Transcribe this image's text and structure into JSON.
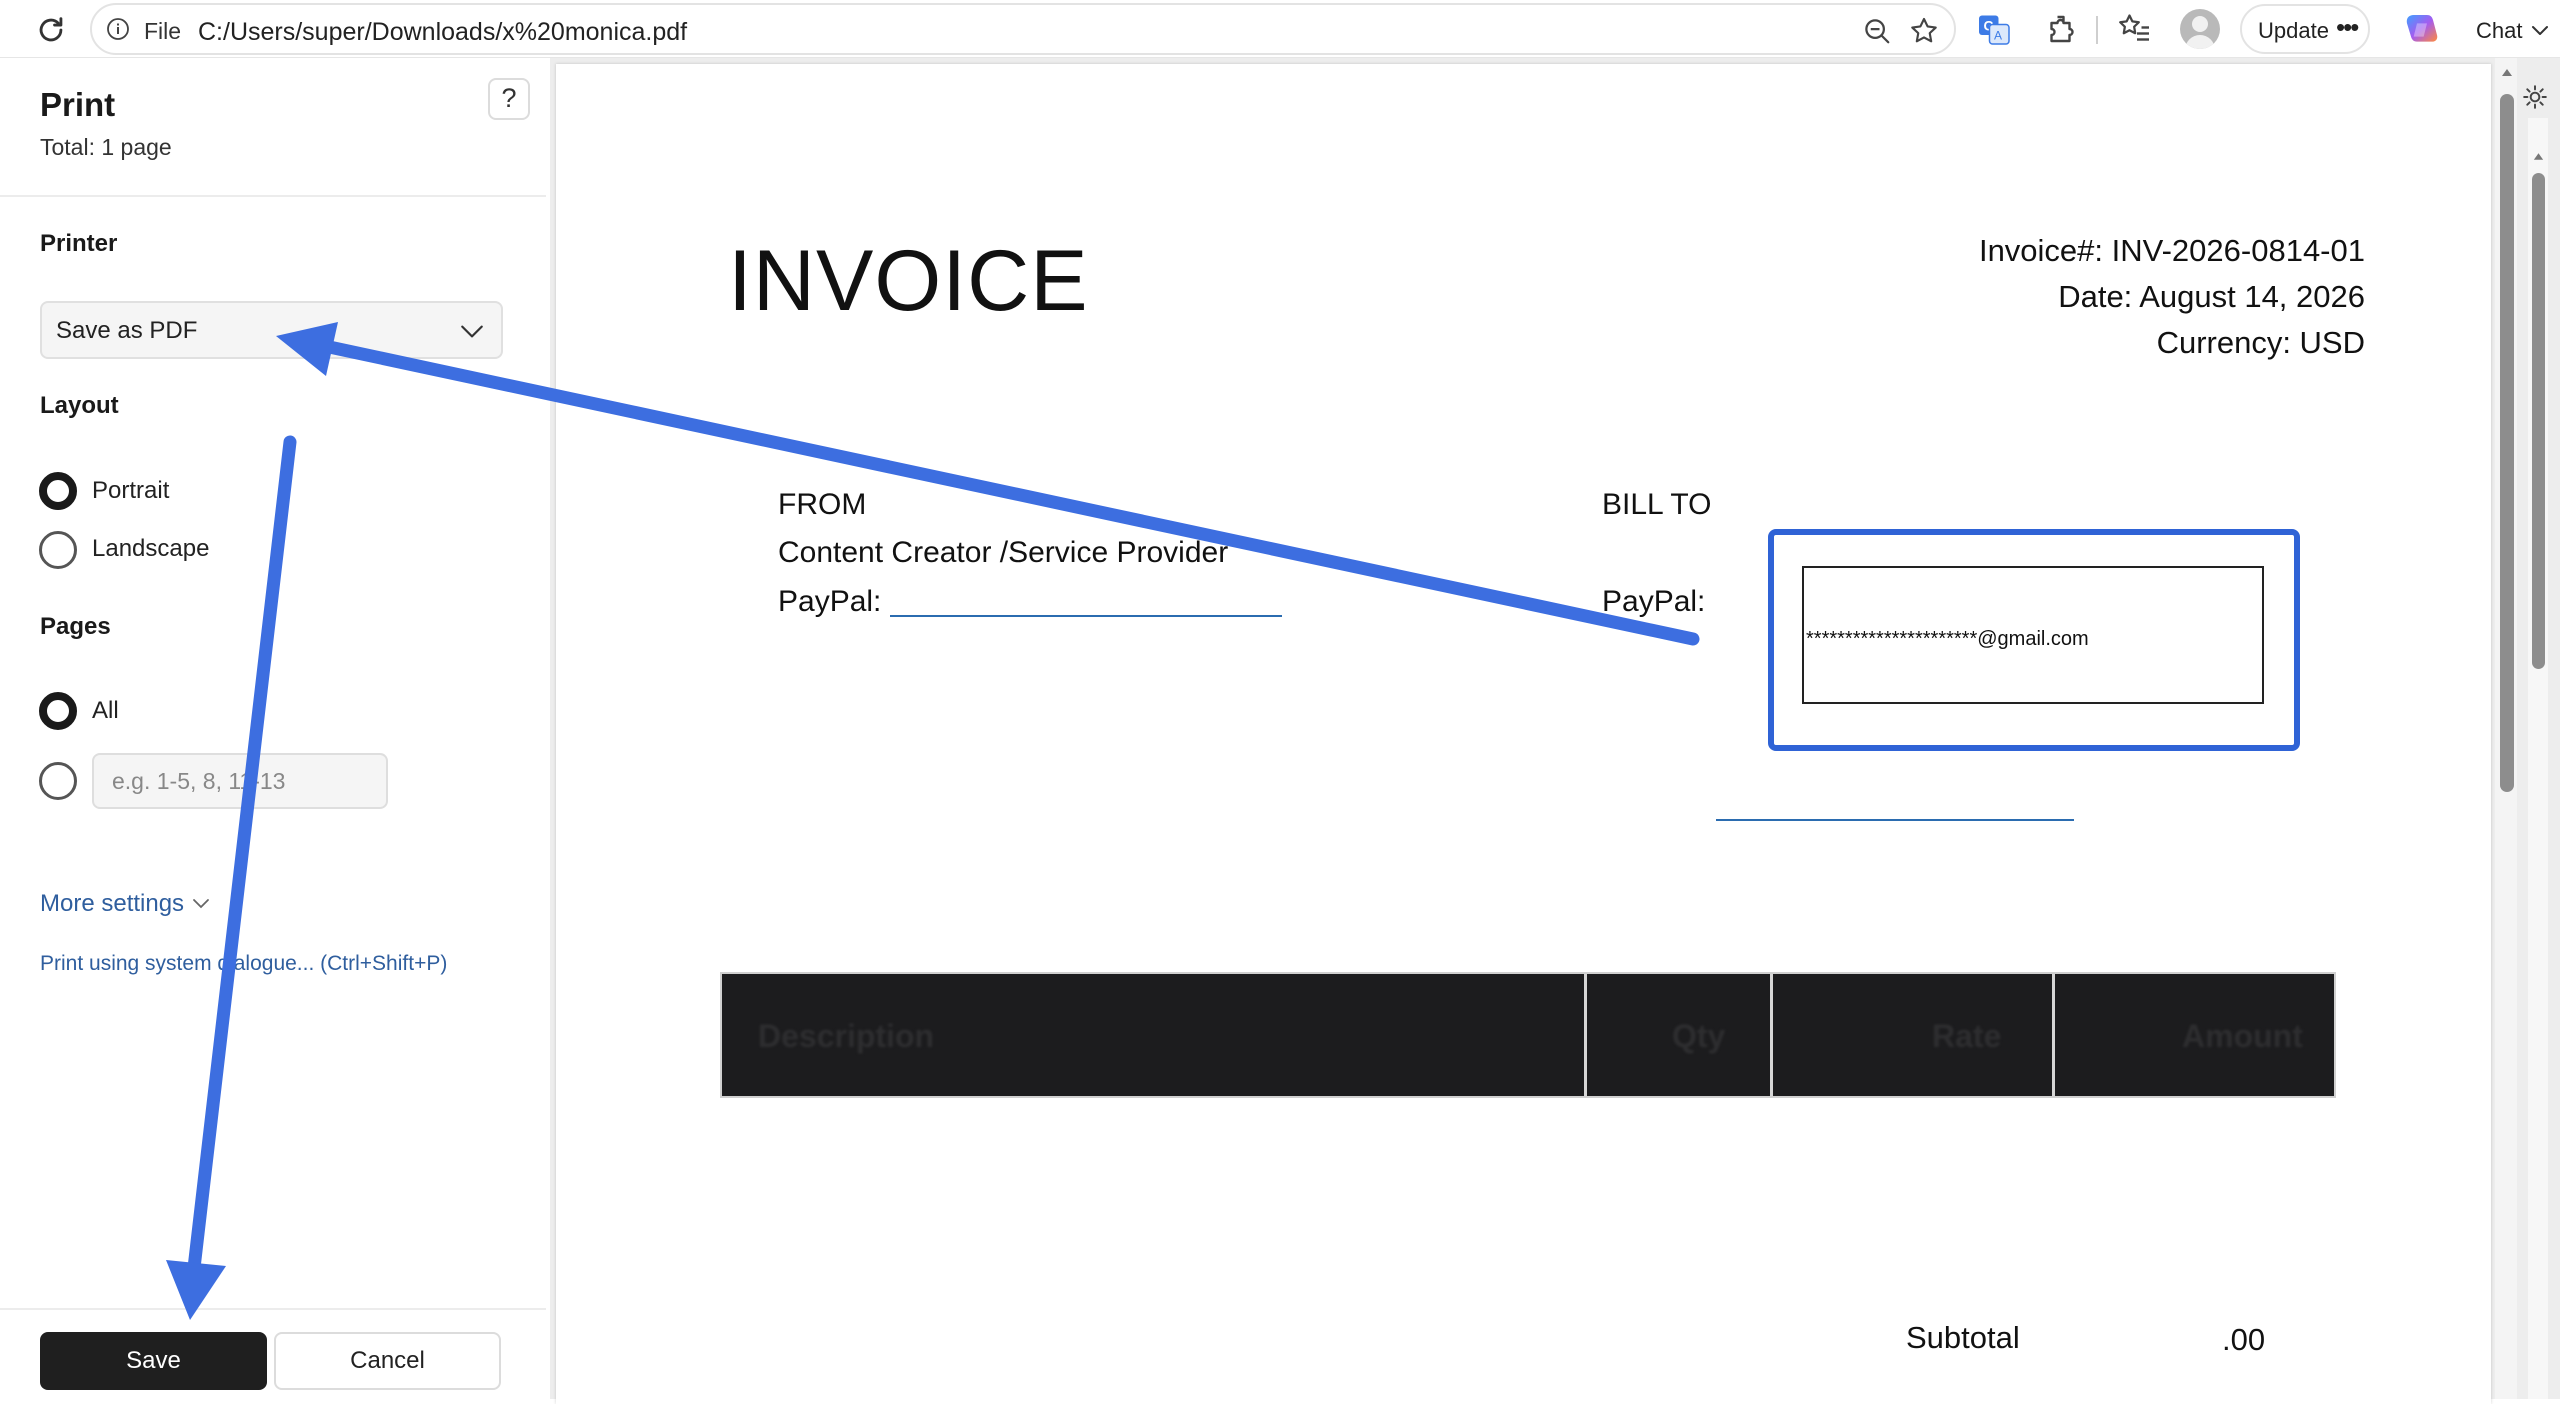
{
  "browser": {
    "address": {
      "scheme": "File",
      "url": "C:/Users/super/Downloads/x%20monica.pdf"
    },
    "update_label": "Update",
    "chat_label": "Chat",
    "icons": [
      "reload-icon",
      "info-icon",
      "zoom-out-icon",
      "favorite-star-icon",
      "translate-icon",
      "extensions-icon",
      "favorites-list-icon",
      "profile-avatar",
      "more-icon",
      "copilot-icon",
      "chevron-down-icon"
    ]
  },
  "print_panel": {
    "title": "Print",
    "total": "Total: 1 page",
    "help_label": "?",
    "printer_label": "Printer",
    "printer_value": "Save as PDF",
    "layout_label": "Layout",
    "layout_options": [
      {
        "label": "Portrait",
        "selected": true
      },
      {
        "label": "Landscape",
        "selected": false
      }
    ],
    "pages_label": "Pages",
    "pages_options": [
      {
        "label": "All",
        "selected": true
      }
    ],
    "pages_custom_placeholder": "e.g. 1-5, 8, 11-13",
    "more_settings": "More settings",
    "system_dialog": "Print using system dialogue... (Ctrl+Shift+P)",
    "save_label": "Save",
    "cancel_label": "Cancel"
  },
  "invoice": {
    "title": "INVOICE",
    "invoice_number": "Invoice#: INV-2026-0814-01",
    "date": "Date: August 14, 2026",
    "currency": "Currency: USD",
    "from_label": "FROM",
    "from_name": "Content Creator /Service Provider",
    "from_paypal_label": "PayPal:",
    "bill_to_label": "BILL TO",
    "bill_to_paypal_label": "PayPal:",
    "bill_to_email": "**********************@gmail.com",
    "table_headers": [
      "Description",
      "Qty",
      "Rate",
      "Amount"
    ],
    "subtotal_label": "Subtotal",
    "subtotal_value": ".00"
  },
  "colors": {
    "annotation_arrow": "#3d6ee0",
    "highlight_border": "#2f63d6",
    "link": "#2f5e9e",
    "primary_button": "#1f1f1f"
  }
}
